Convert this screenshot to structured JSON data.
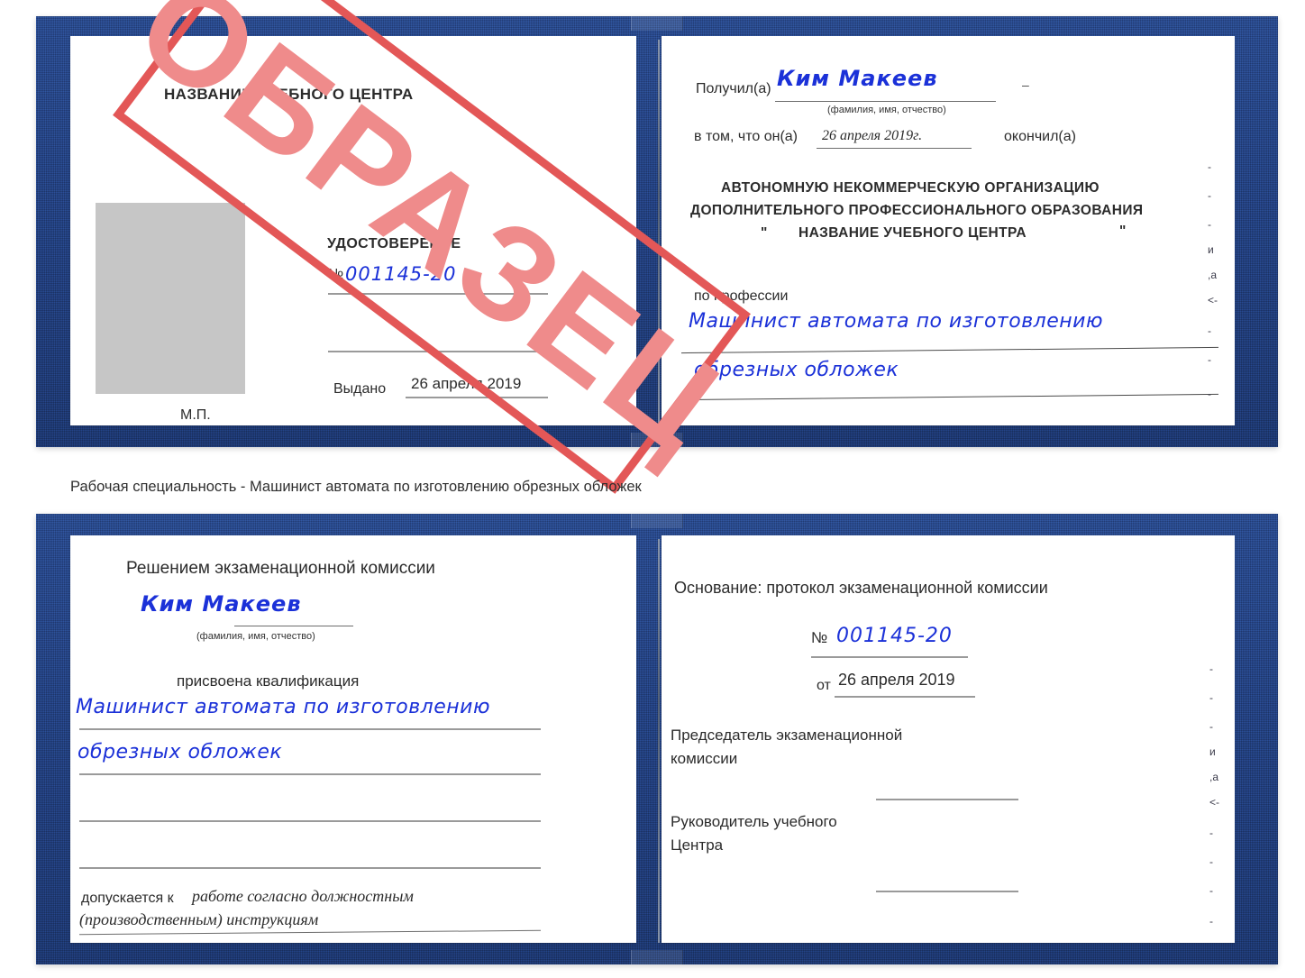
{
  "caption": "Рабочая специальность - Машинист автомата по изготовлению обрезных обложек",
  "stamp": {
    "label": "ОБРАЗЕЦ",
    "color": "#ef8b8b",
    "border_color": "#e35757"
  },
  "colors": {
    "cover": "#23407e",
    "ink": "#1b31d8",
    "rule": "#9a9a9a",
    "photo_box": "#c6c6c6"
  },
  "certificate_top": {
    "left_page": {
      "org_title": "НАЗВАНИЕ УЧЕБНОГО ЦЕНТРА",
      "doc_type": "УДОСТОВЕРЕНИЕ",
      "number_prefix": "№",
      "number_value": "001145-20",
      "issued_label": "Выдано",
      "issued_value": "26 апреля 2019",
      "seal_label": "М.П."
    },
    "right_page": {
      "received_label": "Получил(а)",
      "received_value": "Ким Макеев",
      "fio_hint": "(фамилия, имя, отчество)",
      "in_that_label": "в том, что он(а)",
      "completion_date": "26 апреля 2019г.",
      "finished_label": "окончил(а)",
      "org_line1": "АВТОНОМНУЮ НЕКОММЕРЧЕСКУЮ ОРГАНИЗАЦИЮ",
      "org_line2": "ДОПОЛНИТЕЛЬНОГО ПРОФЕССИОНАЛЬНОГО ОБРАЗОВАНИЯ",
      "org_quote_open": "\"",
      "org_line3": "НАЗВАНИЕ УЧЕБНОГО ЦЕНТРА",
      "org_quote_close": "\"",
      "profession_label": "по профессии",
      "profession_value_line1": "Машинист автомата по изготовлению",
      "profession_value_line2": "обрезных обложек",
      "edge_fragments": [
        "-",
        "-",
        "-",
        "и",
        ",а",
        "<-",
        "-",
        "-",
        "-"
      ]
    }
  },
  "certificate_bottom": {
    "left_page": {
      "decision_title": "Решением экзаменационной комиссии",
      "name_value": "Ким Макеев",
      "fio_hint": "(фамилия, имя, отчество)",
      "qualification_label": "присвоена квалификация",
      "qualification_line1": "Машинист автомата по изготовлению",
      "qualification_line2": "обрезных обложек",
      "admitted_label": "допускается к",
      "admitted_value_line1": "работе согласно должностным",
      "admitted_value_line2": "(производственным) инструкциям"
    },
    "right_page": {
      "basis_label": "Основание: протокол экзаменационной комиссии",
      "number_prefix": "№",
      "number_value": "001145-20",
      "date_prefix": "от",
      "date_value": "26 апреля 2019",
      "chairman_line1": "Председатель экзаменационной",
      "chairman_line2": "комиссии",
      "head_line1": "Руководитель учебного",
      "head_line2": "Центра",
      "edge_fragments": [
        "-",
        "-",
        "-",
        "и",
        ",а",
        "<-",
        "-",
        "-",
        "-",
        "-"
      ]
    }
  }
}
